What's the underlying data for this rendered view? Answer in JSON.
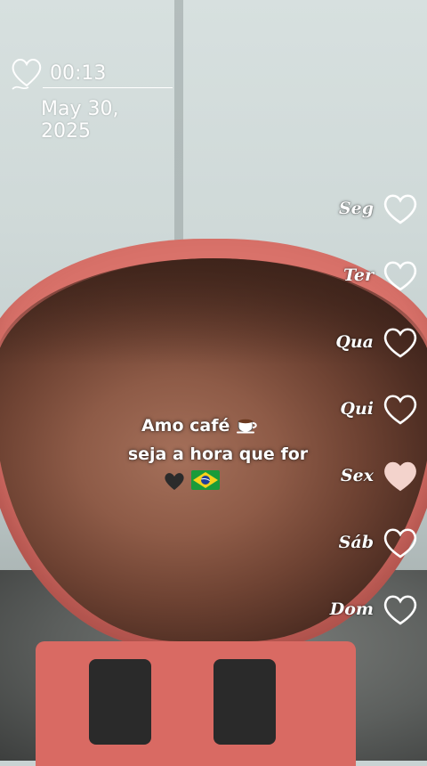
{
  "clock": {
    "time": "00:13",
    "date": "May 30, 2025",
    "icon": "heart-outline-icon"
  },
  "weekdays": [
    {
      "label": "Seg",
      "filled": false
    },
    {
      "label": "Ter",
      "filled": false
    },
    {
      "label": "Qua",
      "filled": false
    },
    {
      "label": "Qui",
      "filled": false
    },
    {
      "label": "Sex",
      "filled": true
    },
    {
      "label": "Sáb",
      "filled": false
    },
    {
      "label": "Dom",
      "filled": false
    }
  ],
  "caption": {
    "line1": "Amo café",
    "line2": "seja a hora que for",
    "icons": [
      "coffee-icon",
      "black-heart-icon",
      "brazil-flag-icon"
    ]
  },
  "colors": {
    "filled_heart": "#f3d3cc",
    "outline_heart": "#ffffff",
    "text": "#ffffff"
  }
}
